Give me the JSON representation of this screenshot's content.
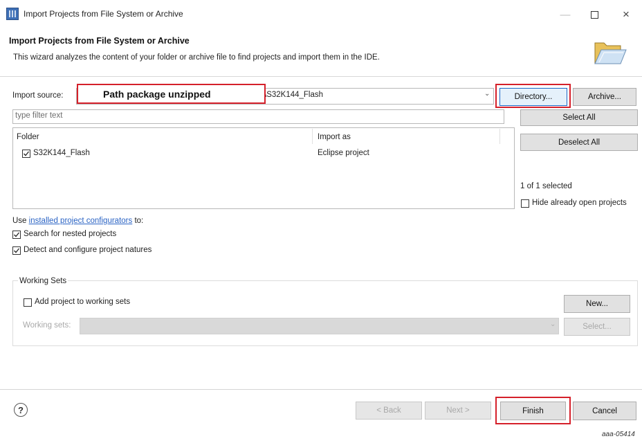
{
  "window": {
    "title": "Import Projects from File System or Archive",
    "controls": {
      "minimize": "—",
      "close": "×"
    }
  },
  "header": {
    "title": "Import Projects from File System or Archive",
    "description": "This wizard analyzes the content of your folder or archive file to find projects and import them in the IDE.",
    "icon": "open-folder-icon"
  },
  "import_source": {
    "label": "Import source:",
    "value": "\\S32K144_Flash",
    "annotation": "Path package unzipped",
    "directory_button": "Directory...",
    "archive_button": "Archive..."
  },
  "filter": {
    "placeholder": "type filter text"
  },
  "projects_table": {
    "columns": [
      "Folder",
      "Import as"
    ],
    "rows": [
      {
        "folder": "S32K144_Flash",
        "import_as": "Eclipse project",
        "checked": true
      }
    ]
  },
  "side_actions": {
    "select_all": "Select All",
    "deselect_all": "Deselect All",
    "selection_status": "1 of 1 selected",
    "hide_open_label": "Hide already open projects",
    "hide_open_checked": false
  },
  "configurators": {
    "prefix": "Use ",
    "link": "installed project configurators",
    "suffix": " to:",
    "options": [
      {
        "label": "Search for nested projects",
        "checked": true
      },
      {
        "label": "Detect and configure project natures",
        "checked": true
      }
    ]
  },
  "working_sets": {
    "title": "Working Sets",
    "add_label": "Add project to working sets",
    "add_checked": false,
    "sets_label": "Working sets:",
    "new_button": "New...",
    "select_button": "Select..."
  },
  "footer": {
    "help": "?",
    "back": "< Back",
    "next": "Next >",
    "finish": "Finish",
    "cancel": "Cancel",
    "figure_code": "aaa-05414"
  },
  "colors": {
    "highlight": "#d5202a",
    "link": "#2a63c4",
    "focus": "#1a66c6"
  }
}
